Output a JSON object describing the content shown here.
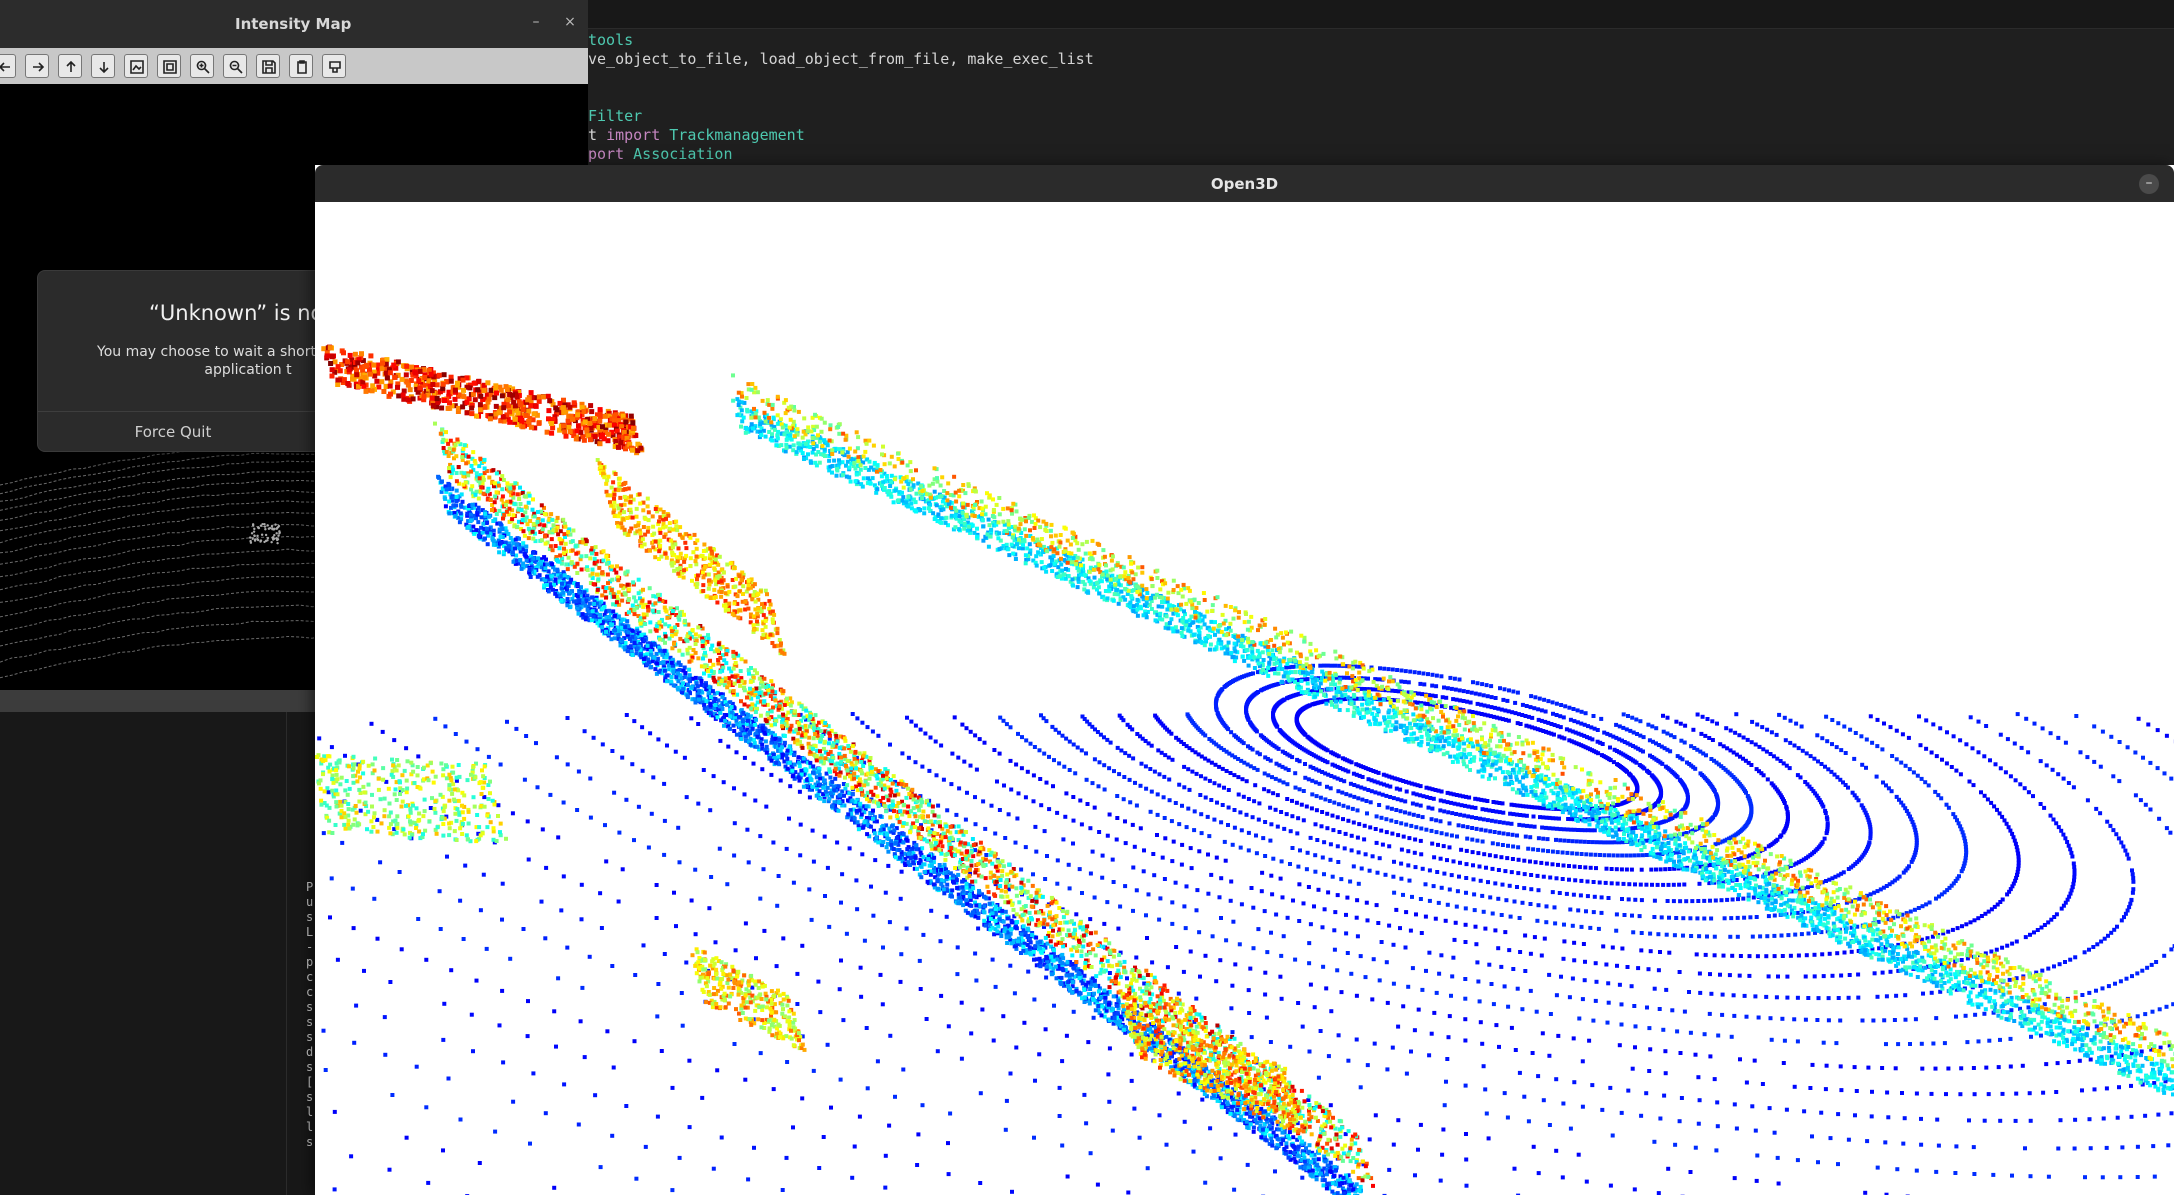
{
  "editor": {
    "code_lines": [
      [
        {
          "t": "tools",
          "c": "cls"
        }
      ],
      [
        {
          "t": "ve_object_to_file",
          "c": "txt"
        },
        {
          "t": ", ",
          "c": "txt"
        },
        {
          "t": "load_object_from_file",
          "c": "txt"
        },
        {
          "t": ", ",
          "c": "txt"
        },
        {
          "t": "make_exec_list",
          "c": "txt"
        }
      ],
      [],
      [],
      [
        {
          "t": "Filter",
          "c": "cls"
        }
      ],
      [
        {
          "t": "t ",
          "c": "txt"
        },
        {
          "t": "import",
          "c": "kw"
        },
        {
          "t": " ",
          "c": "txt"
        },
        {
          "t": "Trackmanagement",
          "c": "cls"
        }
      ],
      [
        {
          "t": "port ",
          "c": "kw"
        },
        {
          "t": "Association",
          "c": "cls"
        }
      ]
    ]
  },
  "terminal": {
    "lines": [
      "P",
      "",
      "u",
      "s",
      "L",
      "",
      "-",
      "p",
      "c",
      "c",
      "s",
      "s",
      "s",
      "d",
      "s",
      "[",
      "s",
      "l",
      "l",
      "s"
    ]
  },
  "intensity_window": {
    "title": "Intensity Map",
    "minimize": "–",
    "close": "×",
    "toolbar_icons": [
      "arrow-left-icon",
      "arrow-right-icon",
      "arrow-up-icon",
      "arrow-down-icon",
      "image-icon",
      "image-sub-icon",
      "zoom-in-icon",
      "zoom-out-icon",
      "save-icon",
      "clipboard-icon",
      "settings-icon"
    ]
  },
  "dialog": {
    "title": "“Unknown” is not r",
    "body": "You may choose to wait a short w force the application t",
    "force_quit": "Force Quit"
  },
  "open3d_window": {
    "title": "Open3D",
    "minimize": "–"
  },
  "colors": {
    "accent_blue": "#1f4fd8",
    "cyan": "#28c8e8",
    "yellow": "#e8e020",
    "orange": "#f08a10",
    "red": "#e02010"
  }
}
